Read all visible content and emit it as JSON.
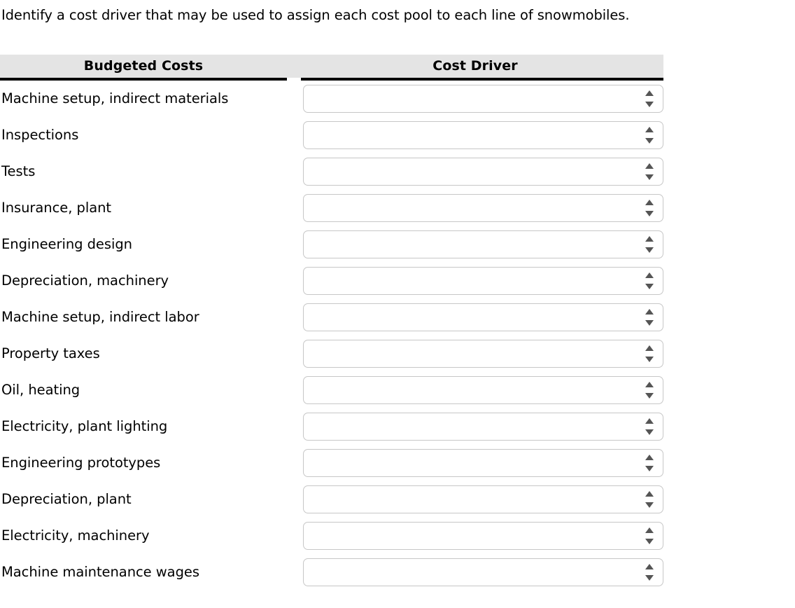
{
  "prompt": "Identify a cost driver that may be used to assign each cost pool to each line of snowmobiles.",
  "table": {
    "headers": {
      "costs": "Budgeted Costs",
      "driver": "Cost Driver"
    },
    "rows": [
      {
        "cost": "Machine setup, indirect materials",
        "driver_value": "",
        "driver_placeholder": ""
      },
      {
        "cost": "Inspections",
        "driver_value": "",
        "driver_placeholder": ""
      },
      {
        "cost": "Tests",
        "driver_value": "",
        "driver_placeholder": ""
      },
      {
        "cost": "Insurance, plant",
        "driver_value": "",
        "driver_placeholder": ""
      },
      {
        "cost": "Engineering design",
        "driver_value": "",
        "driver_placeholder": ""
      },
      {
        "cost": "Depreciation, machinery",
        "driver_value": "",
        "driver_placeholder": ""
      },
      {
        "cost": "Machine setup, indirect labor",
        "driver_value": "",
        "driver_placeholder": ""
      },
      {
        "cost": "Property taxes",
        "driver_value": "",
        "driver_placeholder": ""
      },
      {
        "cost": "Oil, heating",
        "driver_value": "",
        "driver_placeholder": ""
      },
      {
        "cost": "Electricity, plant lighting",
        "driver_value": "",
        "driver_placeholder": ""
      },
      {
        "cost": "Engineering prototypes",
        "driver_value": "",
        "driver_placeholder": ""
      },
      {
        "cost": "Depreciation, plant",
        "driver_value": "",
        "driver_placeholder": ""
      },
      {
        "cost": "Electricity, machinery",
        "driver_value": "",
        "driver_placeholder": ""
      },
      {
        "cost": "Machine maintenance wages",
        "driver_value": "",
        "driver_placeholder": ""
      }
    ]
  },
  "colors": {
    "header_background": "#e4e4e4",
    "header_rule": "#000000",
    "select_border": "#c7c7c7",
    "select_background": "#ffffff",
    "spinner_arrow": "#555555",
    "text": "#000000"
  },
  "icons": {
    "spinner_up": "triangle-up-icon",
    "spinner_down": "triangle-down-icon"
  }
}
